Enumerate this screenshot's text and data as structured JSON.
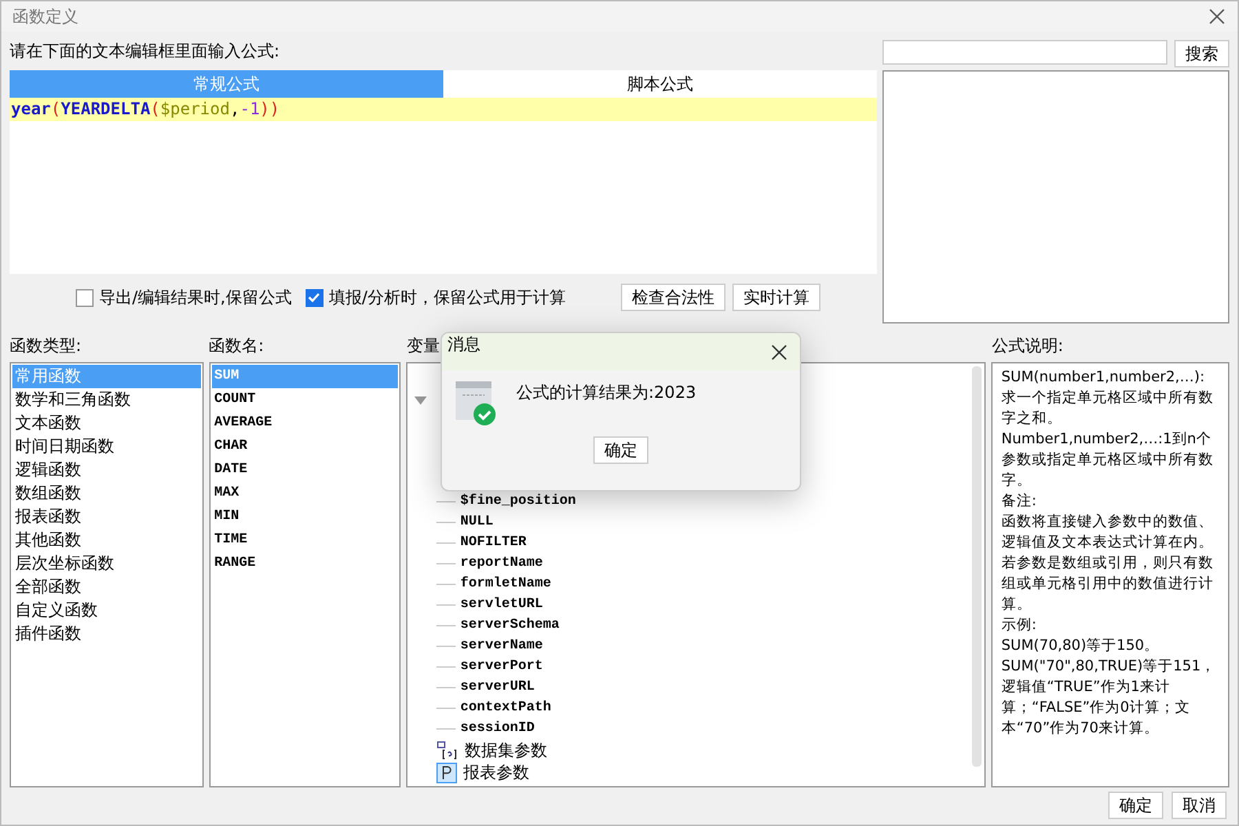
{
  "window": {
    "title": "函数定义"
  },
  "prompt": "请在下面的文本编辑框里面输入公式:",
  "tabs": [
    {
      "label": "常规公式",
      "selected": true
    },
    {
      "label": "脚本公式",
      "selected": false
    }
  ],
  "formula": [
    {
      "kind": "func",
      "text": "year"
    },
    {
      "kind": "paren",
      "text": "("
    },
    {
      "kind": "func",
      "text": "YEARDELTA"
    },
    {
      "kind": "paren",
      "text": "("
    },
    {
      "kind": "var",
      "text": "$period"
    },
    {
      "kind": "punct",
      "text": ","
    },
    {
      "kind": "num",
      "text": "-1"
    },
    {
      "kind": "paren",
      "text": "))"
    }
  ],
  "search": {
    "button": "搜索"
  },
  "options": [
    {
      "label": "导出/编辑结果时,保留公式",
      "checked": false
    },
    {
      "label": "填报/分析时，保留公式用于计算",
      "checked": true
    }
  ],
  "actions": [
    "检查合法性",
    "实时计算"
  ],
  "function_types": {
    "label": "函数类型:",
    "items": [
      {
        "label": "常用函数",
        "selected": true
      },
      {
        "label": "数学和三角函数",
        "selected": false
      },
      {
        "label": "文本函数",
        "selected": false
      },
      {
        "label": "时间日期函数",
        "selected": false
      },
      {
        "label": "逻辑函数",
        "selected": false
      },
      {
        "label": "数组函数",
        "selected": false
      },
      {
        "label": "报表函数",
        "selected": false
      },
      {
        "label": "其他函数",
        "selected": false
      },
      {
        "label": "层次坐标函数",
        "selected": false
      },
      {
        "label": "全部函数",
        "selected": false
      },
      {
        "label": "自定义函数",
        "selected": false
      },
      {
        "label": "插件函数",
        "selected": false
      }
    ]
  },
  "function_names": {
    "label": "函数名:",
    "items": [
      {
        "label": "SUM",
        "selected": true
      },
      {
        "label": "COUNT",
        "selected": false
      },
      {
        "label": "AVERAGE",
        "selected": false
      },
      {
        "label": "CHAR",
        "selected": false
      },
      {
        "label": "DATE",
        "selected": false
      },
      {
        "label": "MAX",
        "selected": false
      },
      {
        "label": "MIN",
        "selected": false
      },
      {
        "label": "TIME",
        "selected": false
      },
      {
        "label": "RANGE",
        "selected": false
      }
    ]
  },
  "variables": {
    "label": "变量",
    "tree": [
      {
        "kind": "folder",
        "expanded": true,
        "children": [
          {
            "label": "$fine_position"
          },
          {
            "label": "NULL"
          },
          {
            "label": "NOFILTER"
          },
          {
            "label": "reportName"
          },
          {
            "label": "formletName"
          },
          {
            "label": "servletURL"
          },
          {
            "label": "serverSchema"
          },
          {
            "label": "serverName"
          },
          {
            "label": "serverPort"
          },
          {
            "label": "serverURL"
          },
          {
            "label": "contextPath"
          },
          {
            "label": "sessionID"
          }
        ]
      },
      {
        "kind": "dataset",
        "label": "数据集参数"
      },
      {
        "kind": "param",
        "label": "报表参数"
      }
    ]
  },
  "description": {
    "label": "公式说明:",
    "lines": [
      "SUM(number1,number2,…):求一个指定单元格区域中所有数字之和。",
      "Number1,number2,…:1到n个参数或指定单元格区域中所有数字。",
      "备注:",
      "函数将直接键入参数中的数值、逻辑值及文本表达式计算在内。若参数是数组或引用，则只有数组或单元格引用中的数值进行计算。",
      "示例:",
      "SUM(70,80)等于150。",
      "SUM(\"70\",80,TRUE)等于151，逻辑值“TRUE”作为1来计算；“FALSE”作为0计算；文本“70”作为70来计算。"
    ]
  },
  "footer": [
    "确定",
    "取消"
  ],
  "message": {
    "title": "消息",
    "text": "公式的计算结果为:2023",
    "button": "确定"
  }
}
